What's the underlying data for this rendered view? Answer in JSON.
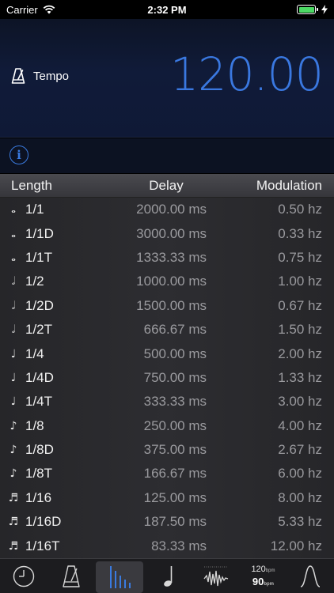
{
  "status_bar": {
    "carrier": "Carrier",
    "time": "2:32 PM"
  },
  "tempo": {
    "label": "Tempo",
    "value": "120.00",
    "accent_color": "#3a78e0"
  },
  "info_button": {
    "icon": "info-icon"
  },
  "table": {
    "headers": {
      "length": "Length",
      "delay": "Delay",
      "modulation": "Modulation"
    },
    "rows": [
      {
        "note": "𝅝",
        "length": "1/1",
        "delay": "2000.00 ms",
        "mod": "0.50 hz"
      },
      {
        "note": "𝅝",
        "length": "1/1D",
        "delay": "3000.00 ms",
        "mod": "0.33 hz"
      },
      {
        "note": "𝅝",
        "length": "1/1T",
        "delay": "1333.33 ms",
        "mod": "0.75 hz"
      },
      {
        "note": "𝅗𝅥",
        "length": "1/2",
        "delay": "1000.00 ms",
        "mod": "1.00 hz"
      },
      {
        "note": "𝅗𝅥",
        "length": "1/2D",
        "delay": "1500.00 ms",
        "mod": "0.67 hz"
      },
      {
        "note": "𝅗𝅥",
        "length": "1/2T",
        "delay": "666.67 ms",
        "mod": "1.50 hz"
      },
      {
        "note": "♩",
        "length": "1/4",
        "delay": "500.00 ms",
        "mod": "2.00 hz"
      },
      {
        "note": "♩",
        "length": "1/4D",
        "delay": "750.00 ms",
        "mod": "1.33 hz"
      },
      {
        "note": "♩",
        "length": "1/4T",
        "delay": "333.33 ms",
        "mod": "3.00 hz"
      },
      {
        "note": "♪",
        "length": "1/8",
        "delay": "250.00 ms",
        "mod": "4.00 hz"
      },
      {
        "note": "♪",
        "length": "1/8D",
        "delay": "375.00 ms",
        "mod": "2.67 hz"
      },
      {
        "note": "♪",
        "length": "1/8T",
        "delay": "166.67 ms",
        "mod": "6.00 hz"
      },
      {
        "note": "♬",
        "length": "1/16",
        "delay": "125.00 ms",
        "mod": "8.00 hz"
      },
      {
        "note": "♬",
        "length": "1/16D",
        "delay": "187.50 ms",
        "mod": "5.33 hz"
      },
      {
        "note": "♬",
        "length": "1/16T",
        "delay": "83.33 ms",
        "mod": "12.00 hz"
      }
    ]
  },
  "tab_bar": {
    "tabs": [
      {
        "icon": "clock-icon"
      },
      {
        "icon": "metronome-icon"
      },
      {
        "icon": "level-bars-icon",
        "active": true
      },
      {
        "icon": "note-icon"
      },
      {
        "icon": "waveform-icon"
      },
      {
        "icon": "bpm-convert-icon",
        "bpm_top": "120",
        "bpm_bottom": "90",
        "unit": "bpm"
      },
      {
        "icon": "curve-icon"
      }
    ]
  }
}
